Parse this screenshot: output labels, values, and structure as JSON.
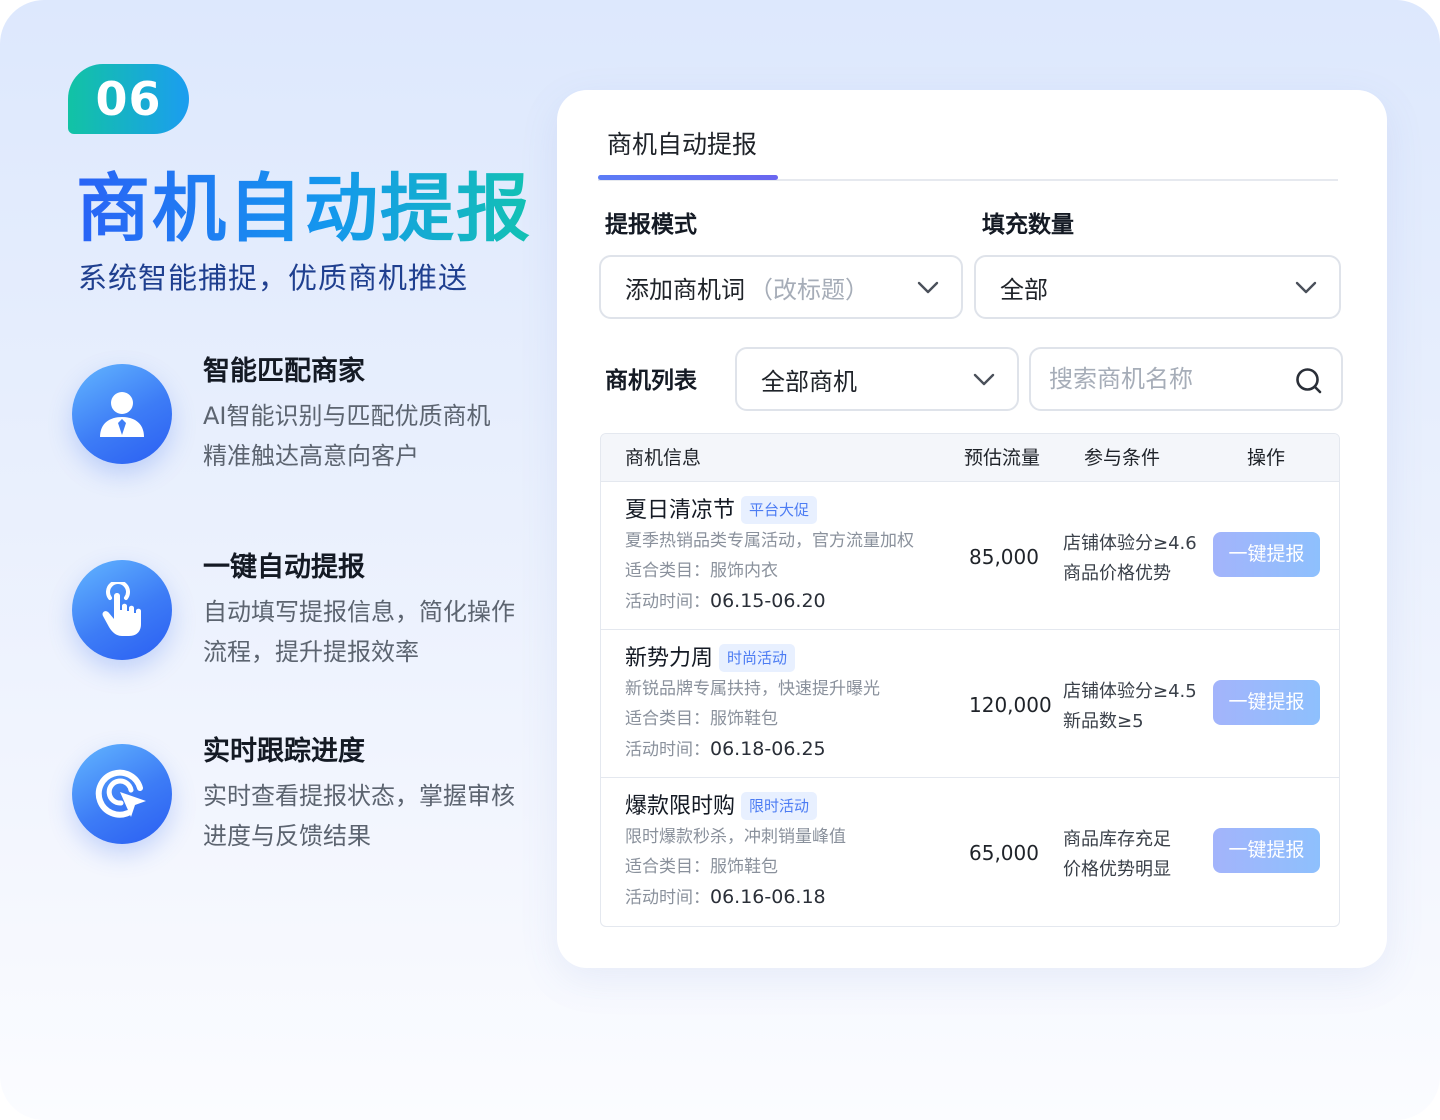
{
  "badge": "06",
  "hero": {
    "title": "商机自动提报",
    "subtitle": "系统智能捕捉，优质商机推送"
  },
  "features": [
    {
      "icon": "person-icon",
      "title": "智能匹配商家",
      "desc": [
        "AI智能识别与匹配优质商机",
        "精准触达高意向客户"
      ]
    },
    {
      "icon": "hand-tap-icon",
      "title": "一键自动提报",
      "desc": [
        "自动填写提报信息，简化操作",
        "流程，提升提报效率"
      ]
    },
    {
      "icon": "target-cursor-icon",
      "title": "实时跟踪进度",
      "desc": [
        "实时查看提报状态，掌握审核",
        "进度与反馈结果"
      ]
    }
  ],
  "panel": {
    "tab": "商机自动提报",
    "mode_label": "提报模式",
    "mode_value": "添加商机词",
    "mode_hint": "（改标题）",
    "fill_label": "填充数量",
    "fill_value": "全部",
    "list_label": "商机列表",
    "list_value": "全部商机",
    "search_placeholder": "搜索商机名称",
    "table": {
      "headers": [
        "商机信息",
        "预估流量",
        "参与条件",
        "操作"
      ],
      "rows": [
        {
          "title": "夏日清凉节",
          "tag": "平台大促",
          "desc": "夏季热销品类专属活动，官方流量加权",
          "category_label": "适合类目：",
          "category": "服饰内衣",
          "time_label": "活动时间：",
          "time": "06.15-06.20",
          "traffic": "85,000",
          "conditions": [
            "店铺体验分≥4.6",
            "商品价格优势"
          ],
          "action": "一键提报"
        },
        {
          "title": "新势力周",
          "tag": "时尚活动",
          "desc": "新锐品牌专属扶持，快速提升曝光",
          "category_label": "适合类目：",
          "category": "服饰鞋包",
          "time_label": "活动时间：",
          "time": "06.18-06.25",
          "traffic": "120,000",
          "conditions": [
            "店铺体验分≥4.5",
            "新品数≥5"
          ],
          "action": "一键提报"
        },
        {
          "title": "爆款限时购",
          "tag": "限时活动",
          "desc": "限时爆款秒杀，冲刺销量峰值",
          "category_label": "适合类目：",
          "category": "服饰鞋包",
          "time_label": "活动时间：",
          "time": "06.16-06.18",
          "traffic": "65,000",
          "conditions": [
            "商品库存充足",
            "价格优势明显"
          ],
          "action": "一键提报"
        }
      ]
    }
  },
  "colors": {
    "accent": "#3d7cf6",
    "badge_start": "#12c3a4",
    "badge_end": "#1b9df0",
    "tag_bg": "#e8f0ff",
    "tag_text": "#4c7cf3",
    "button": "#8ec0fd"
  }
}
